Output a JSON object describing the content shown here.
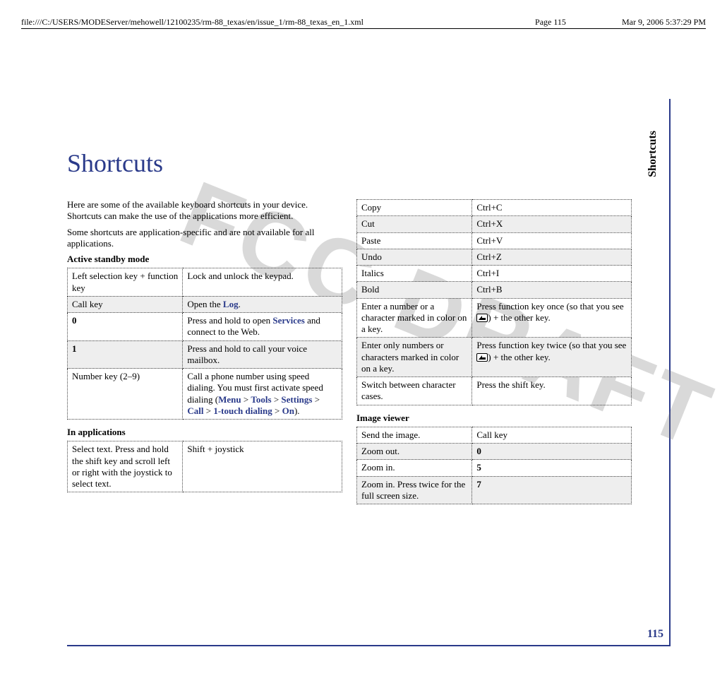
{
  "header": {
    "path": "file:///C:/USERS/MODEServer/mehowell/12100235/rm-88_texas/en/issue_1/rm-88_texas_en_1.xml",
    "page": "Page 115",
    "date": "Mar 9, 2006 5:37:29 PM"
  },
  "side_tab": "Shortcuts",
  "title": "Shortcuts",
  "watermark": "FCC DRAFT",
  "intro": {
    "p1": "Here are some of the available keyboard shortcuts in your device. Shortcuts can make the use of the applications more efficient.",
    "p2": "Some shortcuts are application-specific and are not available for all applications."
  },
  "sections": {
    "active_standby": {
      "heading": "Active standby mode",
      "rows": [
        {
          "l": "Left selection key + function key",
          "r": "Lock and unlock the keypad."
        },
        {
          "l": "Call key",
          "r_prefix": "Open the ",
          "r_link": "Log",
          "r_suffix": "."
        },
        {
          "l": "0",
          "l_bold": true,
          "r_prefix": "Press and hold to open ",
          "r_link": "Services",
          "r_suffix": " and connect to the Web."
        },
        {
          "l": "1",
          "l_bold": true,
          "r": "Press and hold to call your voice mailbox."
        },
        {
          "l": "Number key (2–9)",
          "r_prefix": "Call a phone number using speed dialing. You must first activate speed dialing (",
          "r_link_path": [
            "Menu",
            "Tools",
            "Settings",
            "Call",
            "1-touch dialing",
            "On"
          ],
          "r_suffix": ")."
        }
      ]
    },
    "in_apps": {
      "heading": "In applications",
      "rows": [
        {
          "l": "Select text. Press and hold the shift key and scroll left or right with the joystick to select text.",
          "r": "Shift + joystick"
        },
        {
          "l": "Copy",
          "r": "Ctrl+C"
        },
        {
          "l": "Cut",
          "r": "Ctrl+X"
        },
        {
          "l": "Paste",
          "r": "Ctrl+V"
        },
        {
          "l": "Undo",
          "r": "Ctrl+Z"
        },
        {
          "l": "Italics",
          "r": "Ctrl+I"
        },
        {
          "l": "Bold",
          "r": "Ctrl+B"
        },
        {
          "l": "Enter a number or a character marked in color on a key.",
          "r_icon_once": true
        },
        {
          "l": "Enter only numbers or characters marked in color on a key.",
          "r_icon_twice": true
        },
        {
          "l": "Switch between character cases.",
          "r": "Press the shift key."
        }
      ],
      "icon_text": {
        "once_pre": "Press function key once (so that you see ",
        "once_post": ") + the other key.",
        "twice_pre": "Press function key twice (so that you see ",
        "twice_post": ") + the other key."
      }
    },
    "image_viewer": {
      "heading": "Image viewer",
      "rows": [
        {
          "l": "Send the image.",
          "r": "Call key"
        },
        {
          "l": "Zoom out.",
          "r": "0",
          "r_bold": true
        },
        {
          "l": "Zoom in.",
          "r": "5",
          "r_bold": true
        },
        {
          "l": "Zoom in. Press twice for the full screen size.",
          "r": "7",
          "r_bold": true
        }
      ]
    }
  },
  "page_number": "115"
}
